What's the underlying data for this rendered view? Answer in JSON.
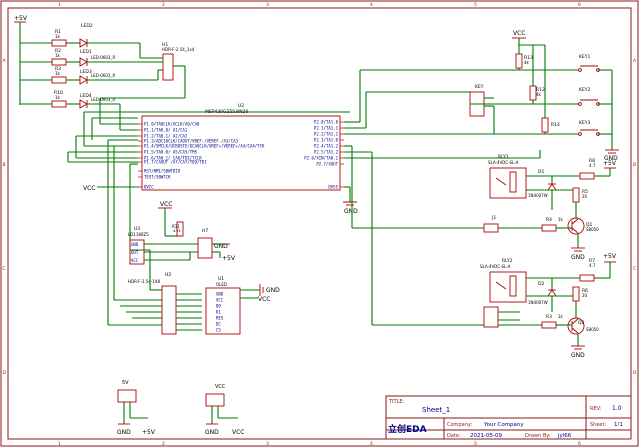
{
  "title_block": {
    "title_label": "TITLE:",
    "title_value": "Sheet_1",
    "rev_label": "REV:",
    "rev_value": "1.0",
    "company_label": "Company:",
    "company_value": "Your Company",
    "sheet_label": "Sheet:",
    "sheet_value": "1/1",
    "date_label": "Date:",
    "date_value": "2021-05-09",
    "drawn_label": "Drawn By:",
    "drawn_value": "jyl66",
    "logo_text": "立创EDA"
  },
  "border": {
    "top_numbers": [
      "1",
      "2",
      "3",
      "4",
      "5",
      "6"
    ],
    "side_letters": [
      "A",
      "B",
      "C",
      "D"
    ]
  },
  "power": {
    "p5v": "+5V",
    "vcc": "VCC",
    "gnd": "GND"
  },
  "leds": {
    "refs": [
      "LED1",
      "LED2",
      "LED3",
      "LED4"
    ],
    "res": [
      "R1",
      "R2",
      "R3",
      "R10"
    ],
    "res_vals": [
      "1k",
      "1k",
      "1k",
      "1k"
    ],
    "color_labels": [
      "LED-0603_R",
      "LED-0603_R",
      "LED-0603_R"
    ]
  },
  "header_h1": {
    "ref": "H1",
    "value": "HDR-F-2.54_1x4"
  },
  "mcu": {
    "ref": "U2",
    "value": "MSP430G2553IN20",
    "left_pins": [
      "P1.0/TA0CLK/ACLK/A0/CA0",
      "P1.1/TA0.0/ A1/CA1",
      "P1.2/TA0.1/ A2/CA2",
      "P1.3/ADC10CLK/CAOUT/VREF-/VEREF-/A3/CA3",
      "P1.4/SMCLK/UCB0STE/UCA0CLK/VREF+/VEREF+/A4/CA4/TCK",
      "P1.5/TA0.0/ A5/CA5/TMS",
      "P1.6/TA0.1/ CA6/TDI/TCLK",
      "P1.7/CAOUT /A7/CA7/TDO/TDI",
      "RST/NMI/SBWTDIO",
      "TEST/SBWTCK",
      "DVCC"
    ],
    "right_pins": [
      "P2.0/TA1.0",
      "P2.1/TA1.1",
      "P2.2/TA1.1",
      "P2.3/TA1.0",
      "P2.4/TA1.2",
      "P2.5/TA1.2",
      "P2.6/XIN/TA0.1",
      "P2.7/XOUT",
      "DVSS"
    ]
  },
  "keys": {
    "refs": [
      "KEY1",
      "KEY2",
      "KEY3"
    ],
    "res": [
      "R13",
      "R12",
      "R14"
    ],
    "res_vals": [
      "4k",
      "4k",
      "4k"
    ],
    "header": "KEY"
  },
  "relays": [
    {
      "ref": "RLY1",
      "value": "SLA-4VDC-SL-A",
      "diode": "D1",
      "diode_val": "1N4007W",
      "r_pull": "R8",
      "r_pull_val": "4.7",
      "r_base": "R4",
      "r_base_val": "1k",
      "r_bias": "R5",
      "r_bias_val": "20",
      "transistor": "Q1",
      "transistor_val": "S8050"
    },
    {
      "ref": "RLY2",
      "value": "SLA-4VDC-SL-A",
      "diode": "D2",
      "diode_val": "1N4007W",
      "r_pull": "R7",
      "r_pull_val": "4.7",
      "r_base": "R3",
      "r_base_val": "1k",
      "r_bias": "R6",
      "r_bias_val": "20",
      "transistor": "Q2",
      "transistor_val": "S8050"
    }
  ],
  "j1": {
    "ref": "J1"
  },
  "dht": {
    "ref": "U3",
    "value": "LD1186Z5",
    "pins": [
      "GND",
      "OUT",
      "VCC"
    ]
  },
  "r11": {
    "ref": "R11",
    "value": "4.7k"
  },
  "h7": {
    "ref": "H7"
  },
  "h2": {
    "ref": "H2",
    "value": "HDR-F-2.54-1X8"
  },
  "oled": {
    "ref": "U1",
    "value": "OLED",
    "pins": [
      "GND",
      "VCC",
      "D0",
      "D1",
      "RES",
      "DC",
      "CS"
    ]
  },
  "power_headers": [
    {
      "label": "5V",
      "pins": [
        "GND",
        "+5V"
      ]
    },
    {
      "label": "VCC",
      "pins": [
        "GND",
        "VCC"
      ]
    }
  ]
}
